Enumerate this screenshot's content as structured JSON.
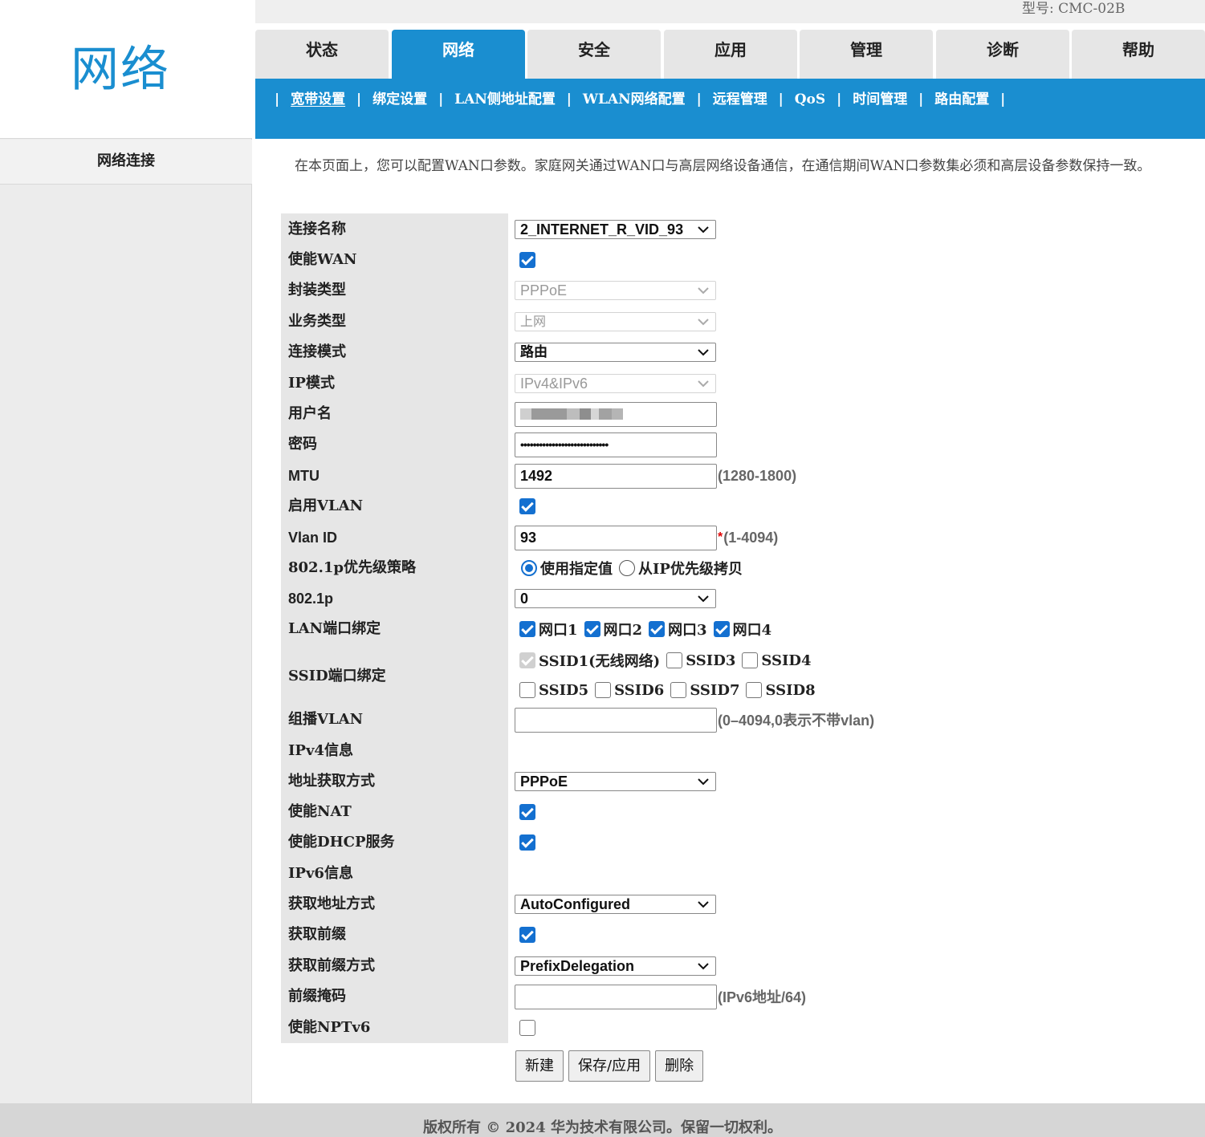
{
  "brand": {
    "logo_text": "网络",
    "model_label": "型号: CMC-02B"
  },
  "sidebar": {
    "items": [
      {
        "label": "网络连接"
      }
    ]
  },
  "tabs": [
    {
      "label": "状态"
    },
    {
      "label": "网络"
    },
    {
      "label": "安全"
    },
    {
      "label": "应用"
    },
    {
      "label": "管理"
    },
    {
      "label": "诊断"
    },
    {
      "label": "帮助"
    }
  ],
  "subnav": [
    {
      "label": "宽带设置"
    },
    {
      "label": "绑定设置"
    },
    {
      "label": "LAN侧地址配置"
    },
    {
      "label": "WLAN网络配置"
    },
    {
      "label": "远程管理"
    },
    {
      "label": "QoS"
    },
    {
      "label": "时间管理"
    },
    {
      "label": "路由配置"
    }
  ],
  "description": "在本页面上，您可以配置WAN口参数。家庭网关通过WAN口与高层网络设备通信，在通信期间WAN口参数集必须和高层设备参数保持一致。",
  "form": {
    "connection_name": {
      "label": "连接名称",
      "value": "2_INTERNET_R_VID_93"
    },
    "enable_wan": {
      "label": "使能WAN",
      "checked": true
    },
    "encapsulation": {
      "label": "封装类型",
      "value": "PPPoE"
    },
    "service_type": {
      "label": "业务类型",
      "value": "上网"
    },
    "connection_mode": {
      "label": "连接模式",
      "value": "路由"
    },
    "ip_mode": {
      "label": "IP模式",
      "value": "IPv4&IPv6"
    },
    "username": {
      "label": "用户名"
    },
    "password": {
      "label": "密码",
      "value": "••••••••••••••••••••••••••••"
    },
    "mtu": {
      "label": "MTU",
      "value": "1492",
      "hint": "(1280-1800)"
    },
    "enable_vlan": {
      "label": "启用VLAN",
      "checked": true
    },
    "vlan_id": {
      "label": "Vlan ID",
      "value": "93",
      "required_mark": "*",
      "hint": "(1-4094)"
    },
    "priority_policy": {
      "label": "802.1p优先级策略",
      "option_specified": "使用指定值",
      "option_copy": "从IP优先级拷贝",
      "selected": "specified"
    },
    "p8021": {
      "label": "802.1p",
      "value": "0"
    },
    "lan_bind": {
      "label": "LAN端口绑定",
      "ports": [
        "网口1",
        "网口2",
        "网口3",
        "网口4"
      ]
    },
    "ssid_bind": {
      "label": "SSID端口绑定",
      "row1": [
        "SSID1(无线网络)",
        "SSID3",
        "SSID4"
      ],
      "row2": [
        "SSID5",
        "SSID6",
        "SSID7",
        "SSID8"
      ]
    },
    "multicast_vlan": {
      "label": "组播VLAN",
      "value": "",
      "hint": "(0–4094,0表示不带vlan)"
    },
    "ipv4_info": {
      "label": "IPv4信息"
    },
    "addr_method": {
      "label": "地址获取方式",
      "value": "PPPoE"
    },
    "enable_nat": {
      "label": "使能NAT",
      "checked": true
    },
    "enable_dhcp": {
      "label": "使能DHCP服务",
      "checked": true
    },
    "ipv6_info": {
      "label": "IPv6信息"
    },
    "ipv6_addr_method": {
      "label": "获取地址方式",
      "value": "AutoConfigured"
    },
    "get_prefix": {
      "label": "获取前缀",
      "checked": true
    },
    "prefix_method": {
      "label": "获取前缀方式",
      "value": "PrefixDelegation"
    },
    "prefix_mask": {
      "label": "前缀掩码",
      "value": "",
      "hint": "(IPv6地址/64)"
    },
    "enable_nptv6": {
      "label": "使能NPTv6",
      "checked": false
    }
  },
  "buttons": {
    "new": "新建",
    "save": "保存/应用",
    "delete": "删除"
  },
  "footer": "版权所有 © 2024 华为技术有限公司。保留一切权利。",
  "colors": {
    "accent": "#1a8ed0",
    "checkbox": "#1470d0",
    "required": "#e00000"
  }
}
